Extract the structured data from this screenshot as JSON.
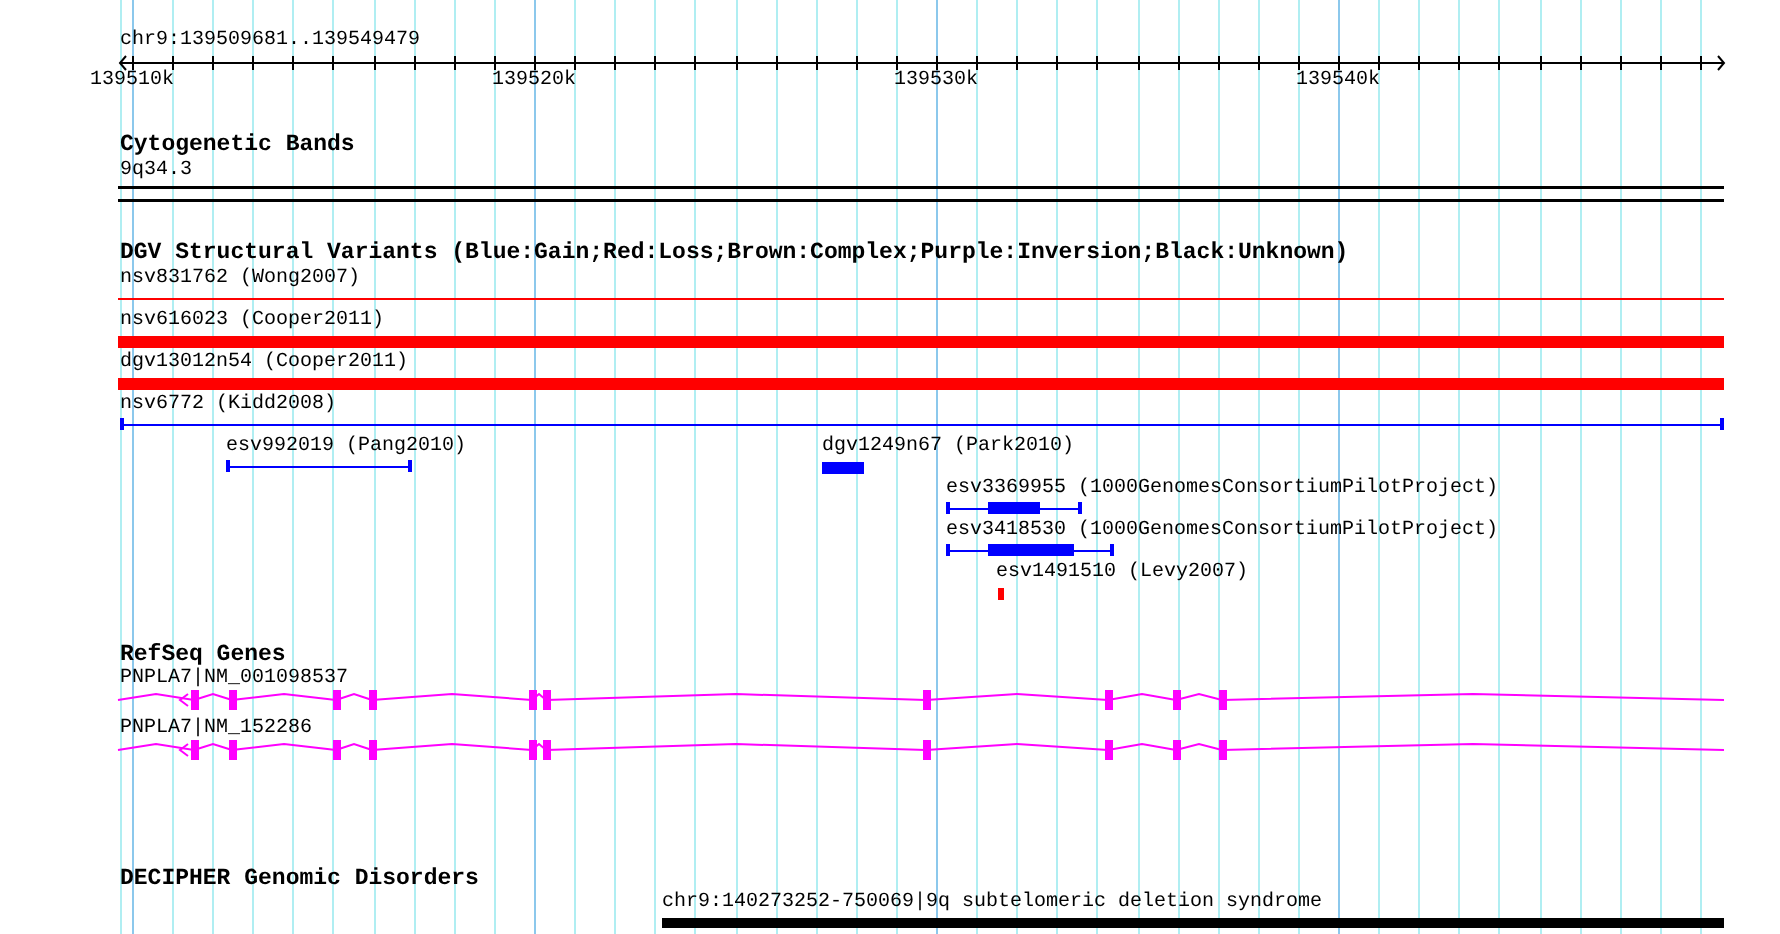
{
  "ruler": {
    "title": "chr9:139509681..139549479",
    "ticks": [
      "139510k",
      "139520k",
      "139530k",
      "139540k"
    ]
  },
  "tracks": [
    {
      "title": "Cytogenetic Bands",
      "features": [
        {
          "kind": "band",
          "label": "9q34.3"
        }
      ]
    },
    {
      "title": "DGV Structural Variants (Blue:Gain;Red:Loss;Brown:Complex;Purple:Inversion;Black:Unknown)",
      "features": [
        {
          "kind": "line",
          "label": "nsv831762 (Wong2007)",
          "color": "#ff0000"
        },
        {
          "kind": "bar",
          "label": "nsv616023 (Cooper2011)",
          "color": "#ff0000"
        },
        {
          "kind": "bar",
          "label": "dgv13012n54 (Cooper2011)",
          "color": "#ff0000"
        },
        {
          "kind": "span",
          "label": "nsv6772 (Kidd2008)",
          "color": "#0000ff"
        },
        {
          "kind": "span",
          "label": "esv992019 (Pang2010)",
          "color": "#0000ff"
        },
        {
          "kind": "block",
          "label": "dgv1249n67 (Park2010)",
          "color": "#0000ff"
        },
        {
          "kind": "span",
          "label": "esv3369955 (1000GenomesConsortiumPilotProject)",
          "color": "#0000ff"
        },
        {
          "kind": "span",
          "label": "esv3418530 (1000GenomesConsortiumPilotProject)",
          "color": "#0000ff"
        },
        {
          "kind": "block",
          "label": "esv1491510 (Levy2007)",
          "color": "#ff0000"
        }
      ]
    },
    {
      "title": "RefSeq Genes",
      "features": [
        {
          "kind": "gene",
          "label": "PNPLA7|NM_001098537"
        },
        {
          "kind": "gene",
          "label": "PNPLA7|NM_152286"
        }
      ]
    },
    {
      "title": "DECIPHER Genomic Disorders",
      "features": [
        {
          "kind": "bar",
          "label": "chr9:140273252-750069|9q subtelomeric deletion syndrome"
        }
      ]
    }
  ]
}
